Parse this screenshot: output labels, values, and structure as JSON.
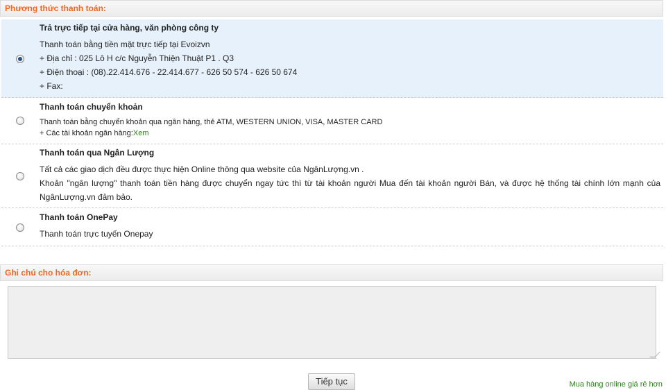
{
  "payment": {
    "header": "Phương thức thanh toán:",
    "methods": [
      {
        "title": "Trả trực tiếp tại cửa hàng, văn phòng công ty",
        "selected": true,
        "lines": [
          "Thanh toán bằng tiền mặt trực tiếp tại  Evoizvn",
          "+ Địa chỉ : 025 Lô H c/c Nguyễn Thiện Thuật P1 . Q3",
          "+ Điện thoại : (08).22.414.676 - 22.414.677 - 626 50 574 - 626 50 674",
          "+ Fax:"
        ]
      },
      {
        "title": "Thanh toán chuyển khoản",
        "selected": false,
        "line1": "Thanh toán bằng chuyển khoản qua ngân hàng, thẻ ATM, WESTERN UNION, VISA, MASTER CARD",
        "line2_prefix": "+ Các tài khoản ngân hàng:",
        "line2_link": "Xem"
      },
      {
        "title": "Thanh toán qua Ngân Lượng",
        "selected": false,
        "line1": "Tất cả các giao dịch đều được thực hiện Online thông qua website của NgânLượng.vn .",
        "line2": "Khoản \"ngân lượng\" thanh toán tiền hàng được chuyển ngay tức thì từ tài khoản người Mua đến tài khoản người Bán, và được hệ thống tài chính lớn mạnh của NgânLượng.vn đảm bảo."
      },
      {
        "title": "Thanh toán OnePay",
        "selected": false,
        "line1": "Thanh toán trực tuyến Onepay"
      }
    ]
  },
  "note": {
    "header": "Ghi chú cho hóa đơn:",
    "value": ""
  },
  "actions": {
    "continue_label": "Tiếp tục"
  },
  "footer": {
    "link": "Mua hàng online giá rẻ hơn"
  },
  "colors": {
    "header_text": "#f26522",
    "selected_row": "#e6f1fb",
    "link": "#2e7d1e"
  }
}
